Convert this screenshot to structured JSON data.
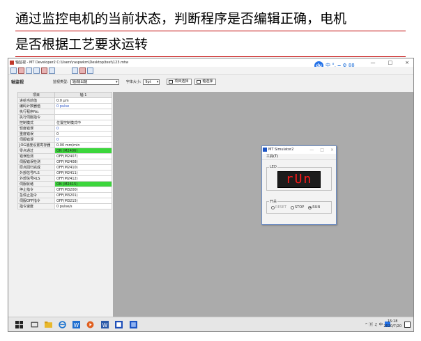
{
  "slide": {
    "title_line1": "通过监控电机的当前状态，判断程序是否编辑正确，电机",
    "title_line2": "是否根据工艺要求运转"
  },
  "window": {
    "title": "轴监视 - MT Developer2 C:\\Users\\raspwkm\\Desktop\\test\\123.mtw",
    "controls": [
      "—",
      "□",
      "×"
    ]
  },
  "ime": {
    "logo": "du",
    "items": "中 °, 🗕 ⚙ 88"
  },
  "panel": {
    "title": "轴监视",
    "monitor_type_label": "监视类型:",
    "monitor_type_value": "轴/输出轴",
    "font_size_label": "字体大小:",
    "font_size_value": "9pt",
    "item_select_label": "项目选择",
    "axis_select_label": "轴选择"
  },
  "grid": {
    "col_item": "项目",
    "col_axis": "轴 1",
    "rows": [
      {
        "name": "进给当前值",
        "value": "0.0 μm",
        "style": ""
      },
      {
        "name": "编码计数器值",
        "value": "0 pulse",
        "style": "blue"
      },
      {
        "name": "执行程序No.",
        "value": "",
        "style": ""
      },
      {
        "name": "执行伺服指令",
        "value": "",
        "style": ""
      },
      {
        "name": "控制模式",
        "value": "位置控制模式中",
        "style": ""
      },
      {
        "name": "轻度错误",
        "value": "0",
        "style": "blue"
      },
      {
        "name": "重度错误",
        "value": "0",
        "style": ""
      },
      {
        "name": "伺服错误",
        "value": "0",
        "style": "blue"
      },
      {
        "name": "JOG速度设置寄存器",
        "value": "0.00 mm/min",
        "style": ""
      },
      {
        "name": "零点通过",
        "value": "ON (M2406)",
        "style": "green"
      },
      {
        "name": "错误检测",
        "value": "OFF(M2407)",
        "style": ""
      },
      {
        "name": "伺服错误检测",
        "value": "OFF(M2408)",
        "style": ""
      },
      {
        "name": "原点回归完成",
        "value": "OFF(M2410)",
        "style": ""
      },
      {
        "name": "外部信号FLS",
        "value": "OFF(M2411)",
        "style": ""
      },
      {
        "name": "外部信号RLS",
        "value": "OFF(M2412)",
        "style": ""
      },
      {
        "name": "伺服就绪",
        "value": "ON (M2415)",
        "style": "green"
      },
      {
        "name": "停止指令",
        "value": "OFF(M3200)",
        "style": ""
      },
      {
        "name": "急停止指令",
        "value": "OFF(M3201)",
        "style": ""
      },
      {
        "name": "伺服OFF指令",
        "value": "OFF(M3215)",
        "style": ""
      },
      {
        "name": "指令速度",
        "value": "0 pulse/s",
        "style": ""
      }
    ]
  },
  "simulator": {
    "title": "MT Simulator2",
    "menu": "工具(T)",
    "led_label": "LED",
    "led_text": "rUn",
    "switch_label": "开关",
    "radios": [
      {
        "label": "RESET",
        "checked": false,
        "dim": true
      },
      {
        "label": "STOP",
        "checked": false,
        "dim": false
      },
      {
        "label": "RUN",
        "checked": true,
        "dim": false
      }
    ]
  },
  "taskbar": {
    "tray": "^ 🄳 ♫ 中",
    "time": "15:18",
    "date": "2020/7/20"
  },
  "colors": {
    "title_rule": "#c00000",
    "on_green": "#3cd63c",
    "led_red": "#ff1a1a",
    "accent_blue": "#2472e8"
  }
}
